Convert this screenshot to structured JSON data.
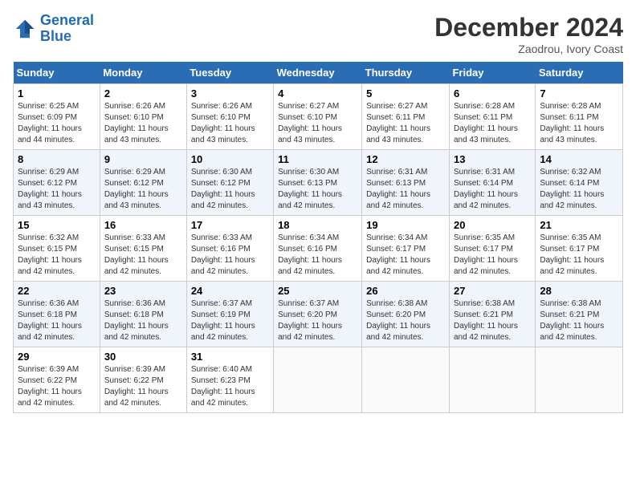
{
  "header": {
    "logo_line1": "General",
    "logo_line2": "Blue",
    "month_title": "December 2024",
    "subtitle": "Zaodrou, Ivory Coast"
  },
  "days_of_week": [
    "Sunday",
    "Monday",
    "Tuesday",
    "Wednesday",
    "Thursday",
    "Friday",
    "Saturday"
  ],
  "weeks": [
    [
      {
        "day": "1",
        "sunrise": "6:25 AM",
        "sunset": "6:09 PM",
        "daylight": "11 hours and 44 minutes."
      },
      {
        "day": "2",
        "sunrise": "6:26 AM",
        "sunset": "6:10 PM",
        "daylight": "11 hours and 43 minutes."
      },
      {
        "day": "3",
        "sunrise": "6:26 AM",
        "sunset": "6:10 PM",
        "daylight": "11 hours and 43 minutes."
      },
      {
        "day": "4",
        "sunrise": "6:27 AM",
        "sunset": "6:10 PM",
        "daylight": "11 hours and 43 minutes."
      },
      {
        "day": "5",
        "sunrise": "6:27 AM",
        "sunset": "6:11 PM",
        "daylight": "11 hours and 43 minutes."
      },
      {
        "day": "6",
        "sunrise": "6:28 AM",
        "sunset": "6:11 PM",
        "daylight": "11 hours and 43 minutes."
      },
      {
        "day": "7",
        "sunrise": "6:28 AM",
        "sunset": "6:11 PM",
        "daylight": "11 hours and 43 minutes."
      }
    ],
    [
      {
        "day": "8",
        "sunrise": "6:29 AM",
        "sunset": "6:12 PM",
        "daylight": "11 hours and 43 minutes."
      },
      {
        "day": "9",
        "sunrise": "6:29 AM",
        "sunset": "6:12 PM",
        "daylight": "11 hours and 43 minutes."
      },
      {
        "day": "10",
        "sunrise": "6:30 AM",
        "sunset": "6:12 PM",
        "daylight": "11 hours and 42 minutes."
      },
      {
        "day": "11",
        "sunrise": "6:30 AM",
        "sunset": "6:13 PM",
        "daylight": "11 hours and 42 minutes."
      },
      {
        "day": "12",
        "sunrise": "6:31 AM",
        "sunset": "6:13 PM",
        "daylight": "11 hours and 42 minutes."
      },
      {
        "day": "13",
        "sunrise": "6:31 AM",
        "sunset": "6:14 PM",
        "daylight": "11 hours and 42 minutes."
      },
      {
        "day": "14",
        "sunrise": "6:32 AM",
        "sunset": "6:14 PM",
        "daylight": "11 hours and 42 minutes."
      }
    ],
    [
      {
        "day": "15",
        "sunrise": "6:32 AM",
        "sunset": "6:15 PM",
        "daylight": "11 hours and 42 minutes."
      },
      {
        "day": "16",
        "sunrise": "6:33 AM",
        "sunset": "6:15 PM",
        "daylight": "11 hours and 42 minutes."
      },
      {
        "day": "17",
        "sunrise": "6:33 AM",
        "sunset": "6:16 PM",
        "daylight": "11 hours and 42 minutes."
      },
      {
        "day": "18",
        "sunrise": "6:34 AM",
        "sunset": "6:16 PM",
        "daylight": "11 hours and 42 minutes."
      },
      {
        "day": "19",
        "sunrise": "6:34 AM",
        "sunset": "6:17 PM",
        "daylight": "11 hours and 42 minutes."
      },
      {
        "day": "20",
        "sunrise": "6:35 AM",
        "sunset": "6:17 PM",
        "daylight": "11 hours and 42 minutes."
      },
      {
        "day": "21",
        "sunrise": "6:35 AM",
        "sunset": "6:17 PM",
        "daylight": "11 hours and 42 minutes."
      }
    ],
    [
      {
        "day": "22",
        "sunrise": "6:36 AM",
        "sunset": "6:18 PM",
        "daylight": "11 hours and 42 minutes."
      },
      {
        "day": "23",
        "sunrise": "6:36 AM",
        "sunset": "6:18 PM",
        "daylight": "11 hours and 42 minutes."
      },
      {
        "day": "24",
        "sunrise": "6:37 AM",
        "sunset": "6:19 PM",
        "daylight": "11 hours and 42 minutes."
      },
      {
        "day": "25",
        "sunrise": "6:37 AM",
        "sunset": "6:20 PM",
        "daylight": "11 hours and 42 minutes."
      },
      {
        "day": "26",
        "sunrise": "6:38 AM",
        "sunset": "6:20 PM",
        "daylight": "11 hours and 42 minutes."
      },
      {
        "day": "27",
        "sunrise": "6:38 AM",
        "sunset": "6:21 PM",
        "daylight": "11 hours and 42 minutes."
      },
      {
        "day": "28",
        "sunrise": "6:38 AM",
        "sunset": "6:21 PM",
        "daylight": "11 hours and 42 minutes."
      }
    ],
    [
      {
        "day": "29",
        "sunrise": "6:39 AM",
        "sunset": "6:22 PM",
        "daylight": "11 hours and 42 minutes."
      },
      {
        "day": "30",
        "sunrise": "6:39 AM",
        "sunset": "6:22 PM",
        "daylight": "11 hours and 42 minutes."
      },
      {
        "day": "31",
        "sunrise": "6:40 AM",
        "sunset": "6:23 PM",
        "daylight": "11 hours and 42 minutes."
      },
      null,
      null,
      null,
      null
    ]
  ]
}
